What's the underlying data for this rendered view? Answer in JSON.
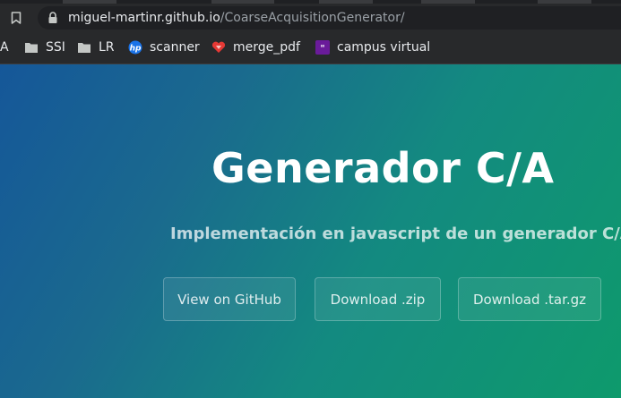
{
  "browser": {
    "url_host": "miguel-martinr.github.io",
    "url_path": "/CoarseAcquisitionGenerator/",
    "bookmarks": [
      {
        "label": "A",
        "icon": "none"
      },
      {
        "label": "SSI",
        "icon": "folder-icon"
      },
      {
        "label": "LR",
        "icon": "folder-icon"
      },
      {
        "label": "scanner",
        "icon": "hp-logo-icon"
      },
      {
        "label": "merge_pdf",
        "icon": "heart-icon"
      },
      {
        "label": "campus virtual",
        "icon": "campus-logo-icon"
      }
    ]
  },
  "page": {
    "title": "Generador C/A",
    "tagline": "Implementación en javascript de un generador C/A",
    "buttons": {
      "github": "View on GitHub",
      "zip": "Download .zip",
      "targz": "Download .tar.gz"
    }
  },
  "colors": {
    "gradient_start": "#155799",
    "gradient_end": "#0e9a6c"
  }
}
